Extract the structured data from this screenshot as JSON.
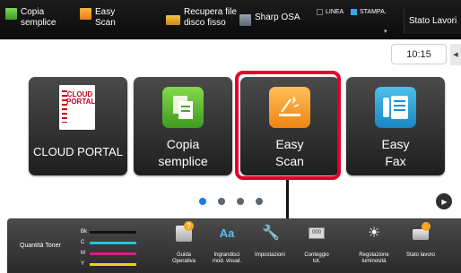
{
  "topbar": {
    "shortcuts": [
      {
        "label": "Copia\nsemplice",
        "icon": "copy-shortcut-icon"
      },
      {
        "label": "Easy\nScan",
        "icon": "scan-shortcut-icon"
      },
      {
        "label": "Recupera file\ndisco fisso",
        "icon": "folder-icon"
      },
      {
        "label": "Sharp OSA",
        "icon": "osa-icon"
      }
    ],
    "status": {
      "linea": "LINEA",
      "stampa": "STAMPA.",
      "linea_color": "#777777",
      "stampa_color": "#3aa7e6"
    },
    "stato_lavori": "Stato Lavori"
  },
  "clock": "10:15",
  "tiles": [
    {
      "label": "CLOUD PORTAL",
      "logo_text": "CLOUD\nPORTAL",
      "icon": "cloud-portal-icon"
    },
    {
      "label": "Copia\nsemplice",
      "icon": "copy-icon",
      "color": "#5cb82e"
    },
    {
      "label": "Easy\nScan",
      "icon": "scan-icon",
      "color": "#f39a1f",
      "highlighted": true
    },
    {
      "label": "Easy\nFax",
      "icon": "fax-icon",
      "color": "#2ba3de"
    }
  ],
  "pagination": {
    "pages": 4,
    "current": 1
  },
  "bottombar": {
    "toner": {
      "label": "Quantità Toner",
      "colors": [
        {
          "name": "Bk",
          "hex": "#111111"
        },
        {
          "name": "C",
          "hex": "#22c4e0"
        },
        {
          "name": "M",
          "hex": "#d81b8c"
        },
        {
          "name": "Y",
          "hex": "#e8d21b"
        }
      ]
    },
    "items": [
      {
        "label": "Guida\nOperativa",
        "icon": "help-guide-icon"
      },
      {
        "label": "Ingrandisci\nmod. visual.",
        "icon": "zoom-text-icon"
      },
      {
        "label": "Impostazioni",
        "icon": "wrench-icon"
      },
      {
        "label": "Conteggio\ntot.",
        "icon": "counter-icon"
      },
      {
        "label": "Regolazione\nluminosità",
        "icon": "brightness-icon"
      },
      {
        "label": "Stato lavoro",
        "icon": "job-status-icon"
      }
    ]
  }
}
